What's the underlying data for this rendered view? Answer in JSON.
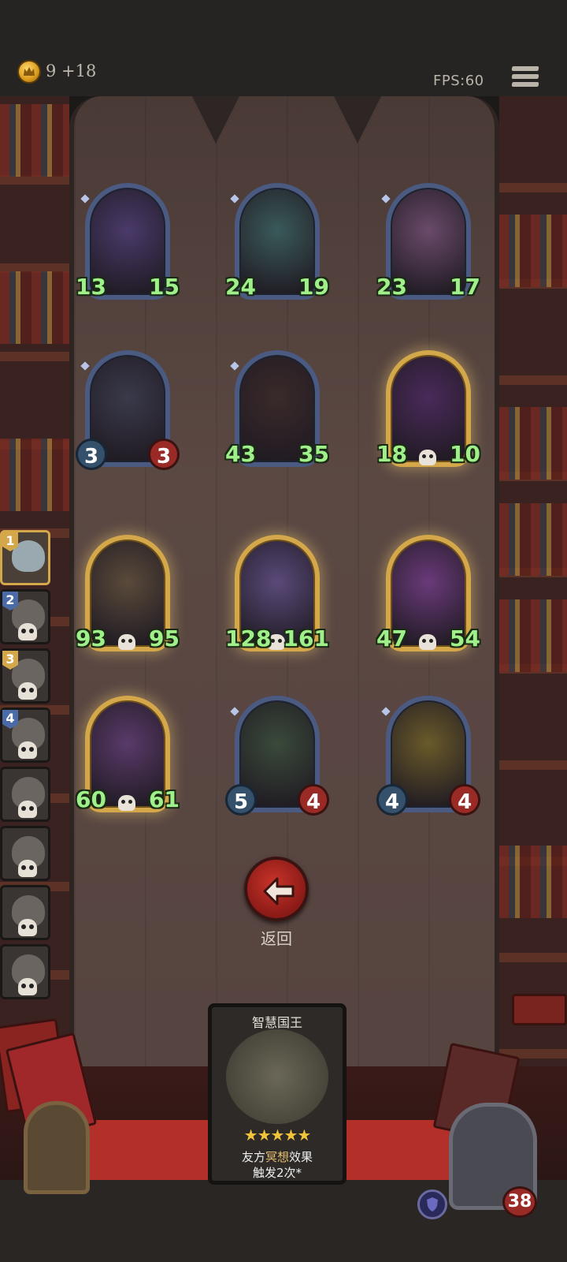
{
  "header": {
    "gold_icon": "crown-coin-icon",
    "gold_text": "9 +18",
    "fps": "FPS:60",
    "menu_icon": "hamburger-menu-icon"
  },
  "board": {
    "cards": [
      {
        "atk": "13",
        "hp": "15",
        "style": "blue",
        "hp_style": "red-burst",
        "hero": "blue-haired-sorceress"
      },
      {
        "atk": "24",
        "hp": "19",
        "style": "blue",
        "hp_style": "red-burst",
        "hero": "blue-crab-beast"
      },
      {
        "atk": "23",
        "hp": "17",
        "style": "blue",
        "hp_style": "plain",
        "hero": "white-bearded-dwarf"
      },
      {
        "atk": "3",
        "hp": "3",
        "style": "blue",
        "hp_style": "badge",
        "hero": "skeleton-knight"
      },
      {
        "atk": "43",
        "hp": "35",
        "style": "blue",
        "hp_style": "plain",
        "hero": "dark-beast-pack"
      },
      {
        "atk": "18",
        "hp": "10",
        "style": "gold",
        "hp_style": "red-burst",
        "hero": "hooded-cultist"
      },
      {
        "atk": "93",
        "hp": "95",
        "style": "gold",
        "hp_style": "red-burst",
        "hero": "red-haired-brute"
      },
      {
        "atk": "128",
        "hp": "161",
        "style": "gold",
        "hp_style": "plain",
        "hero": "grey-ghost-troll"
      },
      {
        "atk": "47",
        "hp": "54",
        "style": "gold",
        "hp_style": "plain",
        "hero": "blue-haired-sorceress"
      },
      {
        "atk": "60",
        "hp": "61",
        "style": "gold",
        "hp_style": "plain",
        "hero": "wise-king"
      },
      {
        "atk": "5",
        "hp": "4",
        "style": "blue",
        "hp_style": "badge",
        "hero": "priestess"
      },
      {
        "atk": "4",
        "hp": "4",
        "style": "blue",
        "hp_style": "badge",
        "hero": "golden-paladin"
      }
    ]
  },
  "queue": [
    {
      "num": "1",
      "active": true
    },
    {
      "num": "2"
    },
    {
      "num": "3"
    },
    {
      "num": "4"
    },
    {
      "num": ""
    },
    {
      "num": ""
    },
    {
      "num": ""
    },
    {
      "num": ""
    }
  ],
  "back_button": {
    "icon": "back-arrow-icon",
    "label": "返回"
  },
  "detail_card": {
    "title": "智慧国王",
    "stars": "★★★★★",
    "desc_prefix": "友方",
    "desc_highlight": "冥想",
    "desc_suffix": "效果",
    "desc_line2": "触发2次*"
  },
  "player": {
    "hp": "38",
    "shield_icon": "shield-icon"
  },
  "colors": {
    "gold_frame": "#d4a84a",
    "blue_frame": "#4a5a80",
    "atk_green": "#9ff08a",
    "back_red": "#b3302a"
  }
}
